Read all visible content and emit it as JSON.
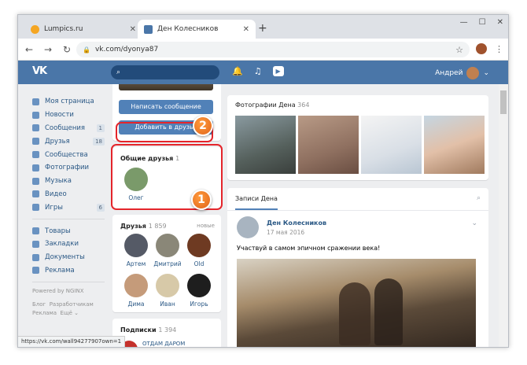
{
  "browser": {
    "tabs": [
      {
        "title": "Lumpics.ru",
        "active": false
      },
      {
        "title": "Ден Колесников",
        "active": true
      }
    ],
    "url": "vk.com/dyonya87",
    "status_url": "https://vk.com/wall94277907own=1"
  },
  "header": {
    "logo": "VK",
    "search_placeholder": "",
    "user_name": "Андрей"
  },
  "menu": {
    "items": [
      {
        "label": "Моя страница",
        "icon": "home-icon",
        "count": ""
      },
      {
        "label": "Новости",
        "icon": "news-icon",
        "count": ""
      },
      {
        "label": "Сообщения",
        "icon": "messages-icon",
        "count": "1"
      },
      {
        "label": "Друзья",
        "icon": "friends-icon",
        "count": "18"
      },
      {
        "label": "Сообщества",
        "icon": "groups-icon",
        "count": ""
      },
      {
        "label": "Фотографии",
        "icon": "photos-icon",
        "count": ""
      },
      {
        "label": "Музыка",
        "icon": "music-icon",
        "count": ""
      },
      {
        "label": "Видео",
        "icon": "video-icon",
        "count": ""
      },
      {
        "label": "Игры",
        "icon": "games-icon",
        "count": "6"
      }
    ],
    "items2": [
      {
        "label": "Товары",
        "icon": "goods-icon"
      },
      {
        "label": "Закладки",
        "icon": "bookmarks-icon"
      },
      {
        "label": "Документы",
        "icon": "documents-icon"
      },
      {
        "label": "Реклама",
        "icon": "ads-icon"
      }
    ],
    "powered": "Powered by NGINX",
    "footer": [
      "Блог",
      "Разработчикам",
      "Реклама",
      "Ещё ⌄"
    ]
  },
  "profile": {
    "write_message": "Написать сообщение",
    "add_friend": "Добавить в друзья",
    "common_friends_title": "Общие друзья",
    "common_friends_count": "1",
    "common_friends": [
      "Олег"
    ],
    "friends_title": "Друзья",
    "friends_count": "1 859",
    "friends_online": "новые",
    "friends": [
      "Артем",
      "Дмитрий",
      "Old",
      "Дима",
      "Иван",
      "Игорь"
    ],
    "subs_title": "Подписки",
    "subs_count": "1 394",
    "sub_item_text": "ОТДАМ ДАРОМ БЕСПЛАТНО ХАЛЯВА"
  },
  "photos": {
    "title": "Фотографии Дена",
    "count": "364"
  },
  "wall": {
    "tab": "Записи Дена",
    "author": "Ден Колесников",
    "date": "17 мая 2016",
    "text": "Участвуй в самом эпичном сражении века!"
  },
  "badges": [
    "1",
    "2"
  ],
  "colors": {
    "vk_blue": "#4a76a8",
    "button": "#5181b8",
    "highlight": "#e4252b",
    "badge": "#e0641a"
  }
}
